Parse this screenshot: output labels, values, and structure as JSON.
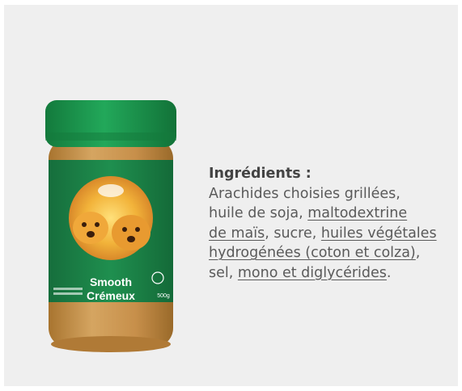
{
  "product": {
    "label_line1": "Smooth",
    "label_line2": "Crémeux",
    "weight": "500g"
  },
  "ingredients": {
    "title": "Ingrédients :",
    "l1": "Arachides choisies grillées,",
    "l2_a": "huile de soja, ",
    "l2_b": "maltodextrine",
    "l3_a": "de maïs",
    "l3_b": ", sucre, ",
    "l3_c": "huiles végétales",
    "l4_a": "hydrogénées (coton et colza)",
    "l4_b": ",",
    "l5_a": "sel, ",
    "l5_b": "mono et diglycérides",
    "l5_c": "."
  },
  "colors": {
    "jar_green": "#1e8c4e",
    "lid_green": "#1a9a4f",
    "peanut_butter": "#c7924e",
    "text": "#5a5a5a"
  }
}
